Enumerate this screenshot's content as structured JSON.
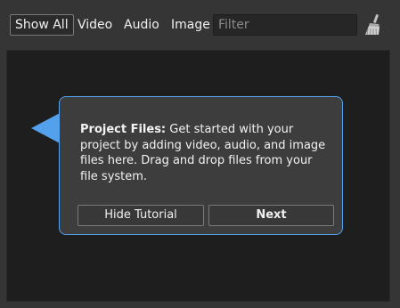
{
  "toolbar": {
    "filters": [
      {
        "label": "Show All",
        "active": true
      },
      {
        "label": "Video",
        "active": false
      },
      {
        "label": "Audio",
        "active": false
      },
      {
        "label": "Image",
        "active": false
      }
    ],
    "search_placeholder": "Filter",
    "clear_icon": "broom-icon"
  },
  "tutorial": {
    "title": "Project Files:",
    "body": " Get started with your project by adding video, audio, and image files here. Drag and drop files from your file system.",
    "hide_label": "Hide Tutorial",
    "next_label": "Next",
    "accent_color": "#53a0ed"
  }
}
